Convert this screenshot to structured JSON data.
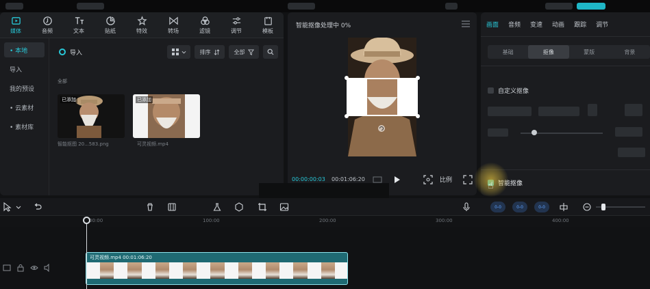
{
  "toolbar": {
    "tools": [
      {
        "name": "media",
        "label": "媒体",
        "active": true
      },
      {
        "name": "audio",
        "label": "音频"
      },
      {
        "name": "text",
        "label": "文本"
      },
      {
        "name": "sticker",
        "label": "贴纸"
      },
      {
        "name": "effects",
        "label": "特效"
      },
      {
        "name": "transition",
        "label": "转场"
      },
      {
        "name": "filter",
        "label": "滤镜"
      },
      {
        "name": "adjust",
        "label": "调节"
      },
      {
        "name": "template",
        "label": "模板"
      }
    ]
  },
  "sidebar": {
    "items": [
      {
        "label": "• 本地",
        "active": true
      },
      {
        "label": "导入"
      },
      {
        "label": "我的预设"
      },
      {
        "label": "• 云素材"
      },
      {
        "label": "• 素材库"
      }
    ]
  },
  "media": {
    "import_label": "导入",
    "sort_label": "排序",
    "all_label": "全部",
    "group_label": "全部",
    "thumbs": [
      {
        "added": "已添加",
        "name": "智能抠图 20...583.png"
      },
      {
        "added": "已添加",
        "name": "可灵视频.mp4"
      }
    ]
  },
  "player": {
    "title": "智能抠像处理中 0%",
    "time_current": "00:00:00:03",
    "time_total": "00:01:06:20",
    "ratio_label": "比例"
  },
  "inspector": {
    "tabs": [
      "画面",
      "音频",
      "变速",
      "动画",
      "跟踪",
      "调节"
    ],
    "subtabs": [
      "基础",
      "抠像",
      "蒙版",
      "背景"
    ],
    "custom_matting": "自定义抠像",
    "enable_label": "智能抠像"
  },
  "timeline": {
    "ticks": [
      "00:00",
      "100:00",
      "200:00",
      "300:00",
      "400:00"
    ],
    "clip_label": "可灵视频.mp4   00:01:06:20",
    "toggles": [
      "0-0",
      "0-0",
      "0-0"
    ]
  },
  "colors": {
    "accent": "#28c8d8",
    "clip": "#1f6a73",
    "clip_border": "#8fe3eb",
    "panel": "#1b1c1f"
  }
}
